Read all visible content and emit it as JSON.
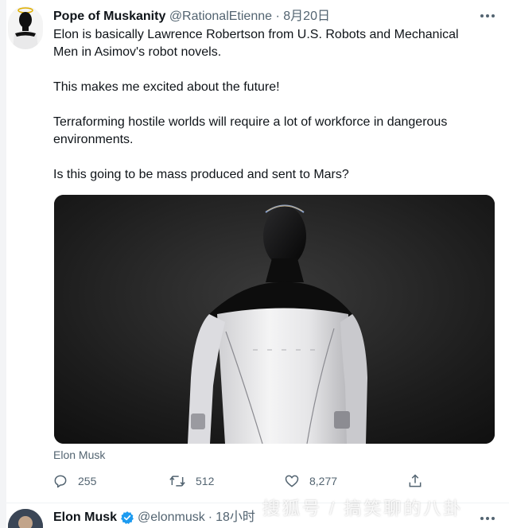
{
  "tweet": {
    "author_name": "Pope of Muskanity",
    "author_handle": "@RationalEtienne",
    "separator": "·",
    "date": "8月20日",
    "paragraphs": [
      "Elon is basically Lawrence Robertson from U.S. Robots and Mechanical Men in Asimov's robot novels.",
      "This makes me excited about the future!",
      "Terraforming hostile worlds will require a lot of workforce in dangerous environments.",
      "Is this going to be mass produced and sent to Mars?"
    ],
    "media_caption": "Elon Musk",
    "actions": {
      "replies": "255",
      "retweets": "512",
      "likes": "8,277"
    }
  },
  "next_tweet": {
    "author_name": "Elon Musk",
    "author_handle": "@elonmusk",
    "separator": "·",
    "time": "18小时"
  },
  "watermark_text": "搜狐号 / 搞笑聊的八卦",
  "icons": {
    "more": "more-horizontal-icon",
    "reply": "reply-icon",
    "retweet": "retweet-icon",
    "like": "heart-icon",
    "share": "share-icon",
    "verified": "verified-badge-icon"
  },
  "colors": {
    "text_primary": "#0f1419",
    "text_secondary": "#536471",
    "verified_blue": "#1d9bf0"
  }
}
